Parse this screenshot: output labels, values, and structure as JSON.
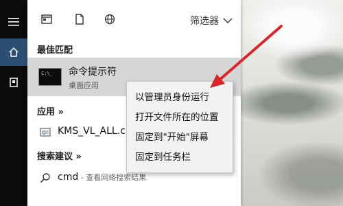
{
  "menu": {
    "filter_label": "筛选器",
    "best_match_header": "最佳匹配",
    "best_match": {
      "title": "命令提示符",
      "subtitle": "桌面应用",
      "thumb_text": "C:\\_"
    },
    "apps_header": "应用 »",
    "app_item": "KMS_VL_ALL.cm",
    "search_suggestions_header": "搜索建议 »",
    "suggestion": {
      "term": "cmd",
      "hint": " - 查看网络搜索结果"
    }
  },
  "context_menu": {
    "items": [
      "以管理员身份运行",
      "打开文件所在的位置",
      "固定到\"开始\"屏幕",
      "固定到任务栏"
    ]
  },
  "colors": {
    "accent": "#2b4e72",
    "arrow": "#d9262b",
    "selected_row": "#d6d6d6"
  }
}
